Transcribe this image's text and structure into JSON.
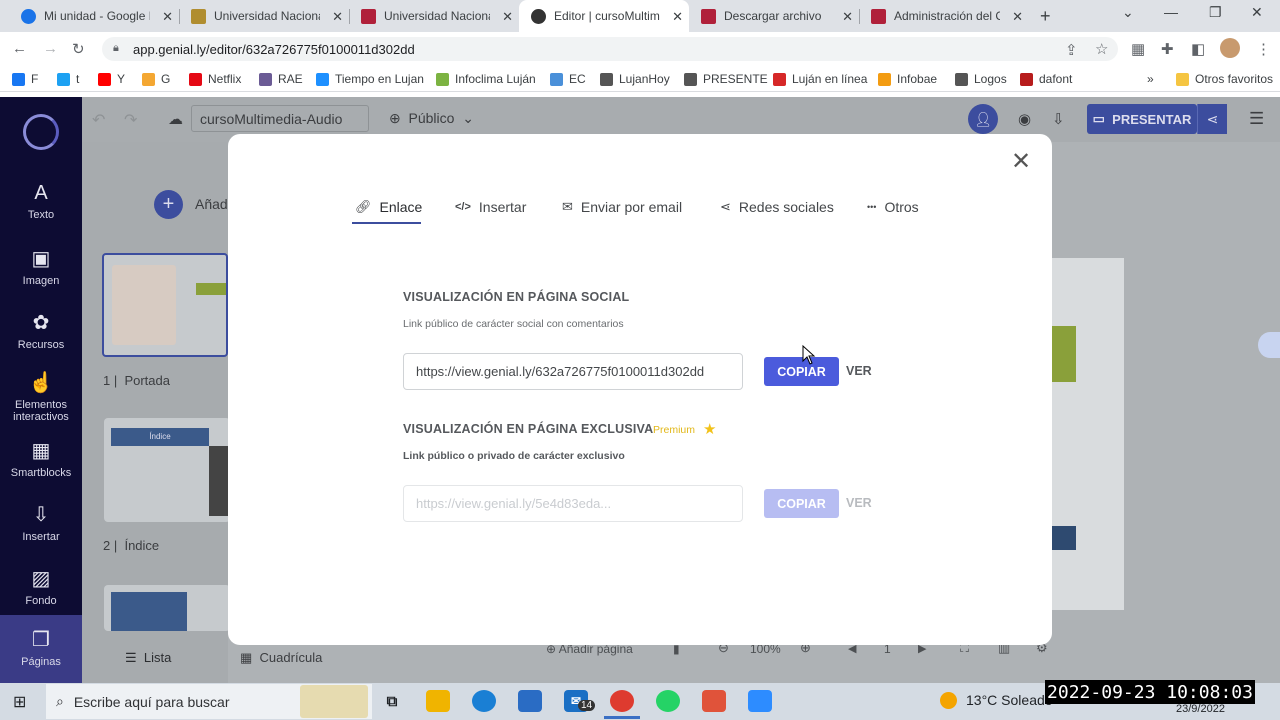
{
  "browser": {
    "tabs": [
      {
        "title": "Mi unidad - Google Drive",
        "icon": "google-drive-icon",
        "color": "#1a73e8"
      },
      {
        "title": "Universidad Nacional de Luján",
        "icon": "university-shield-icon",
        "color": "#b08d2f"
      },
      {
        "title": "Universidad Nacional de Luján",
        "icon": "moodle-icon",
        "color": "#b0203a"
      },
      {
        "title": "Editor | cursoMultimedia-Audio",
        "icon": "genially-icon",
        "color": "#333333"
      },
      {
        "title": "Descargar archivo",
        "icon": "moodle-icon",
        "color": "#b0203a"
      },
      {
        "title": "Administración del Campus",
        "icon": "moodle-icon",
        "color": "#b0203a"
      }
    ],
    "url": "app.genial.ly/editor/632a726775f0100011d302dd",
    "bookmarks": [
      {
        "label": "F",
        "color": "#1877f2"
      },
      {
        "label": "t",
        "color": "#1da1f2"
      },
      {
        "label": "Y",
        "color": "#ff0000"
      },
      {
        "label": "G",
        "color": "#f4a732"
      },
      {
        "label": "Netflix",
        "color": "#e50914"
      },
      {
        "label": "RAE",
        "color": "#6b5b95"
      },
      {
        "label": "Tiempo en Lujan",
        "color": "#1e90ff"
      },
      {
        "label": "Infoclima Luján",
        "color": "#7cb342"
      },
      {
        "label": "EC",
        "color": "#4a90d9"
      },
      {
        "label": "LujanHoy",
        "color": "#555555"
      },
      {
        "label": "PRESENTE",
        "color": "#555555"
      },
      {
        "label": "Luján en línea",
        "color": "#d62828"
      },
      {
        "label": "Infobae",
        "color": "#f39c12"
      },
      {
        "label": "Logos",
        "color": "#555555"
      },
      {
        "label": "dafont",
        "color": "#b71c1c"
      }
    ],
    "bookmarks_more": "»",
    "other_bookmarks": "Otros favoritos"
  },
  "app": {
    "sidebar": [
      {
        "label": "Texto",
        "glyph": "A"
      },
      {
        "label": "Imagen",
        "glyph": "▣"
      },
      {
        "label": "Recursos",
        "glyph": "✿"
      },
      {
        "label": "Elementos interactivos",
        "glyph": "☝"
      },
      {
        "label": "Smartblocks",
        "glyph": "▦"
      },
      {
        "label": "Insertar",
        "glyph": "⇩"
      },
      {
        "label": "Fondo",
        "glyph": "▨"
      },
      {
        "label": "Páginas",
        "glyph": "❐"
      }
    ],
    "filename": "cursoMultimedia-Audio",
    "visibility": "Público",
    "present": "PRESENTAR",
    "add_page_label": "Añadir",
    "pages": [
      {
        "num": "1",
        "name": "Portada"
      },
      {
        "num": "2",
        "name": "Índice"
      }
    ],
    "thumb2_heading": "Índice",
    "list_tab": "Lista",
    "grid_tab": "Cuadrícula",
    "bottom_add_page": "Añadir página",
    "zoom": "100%",
    "page_index": "1"
  },
  "modal": {
    "tabs": [
      {
        "label": "Enlace",
        "icon": "link-icon"
      },
      {
        "label": "Insertar",
        "icon": "code-icon"
      },
      {
        "label": "Enviar por email",
        "icon": "email-icon"
      },
      {
        "label": "Redes sociales",
        "icon": "share-icon"
      },
      {
        "label": "Otros",
        "icon": "more-icon"
      }
    ],
    "social": {
      "title": "VISUALIZACIÓN EN PÁGINA SOCIAL",
      "subtitle": "Link público de carácter social con comentarios",
      "url": "https://view.genial.ly/632a726775f0100011d302dd",
      "copy": "COPIAR",
      "view": "VER"
    },
    "exclusive": {
      "title": "VISUALIZACIÓN EN PÁGINA EXCLUSIVA",
      "badge": "Premium",
      "subtitle": "Link público o privado de carácter exclusivo",
      "url": "https://view.genial.ly/5e4d83eda...",
      "copy": "COPIAR",
      "view": "VER"
    }
  },
  "taskbar": {
    "search_placeholder": "Escribe aquí para buscar",
    "weather": "13°C  Soleado",
    "clock": "2022-09-23  10:08:03",
    "date": "23/9/2022",
    "mail_badge": "14"
  }
}
